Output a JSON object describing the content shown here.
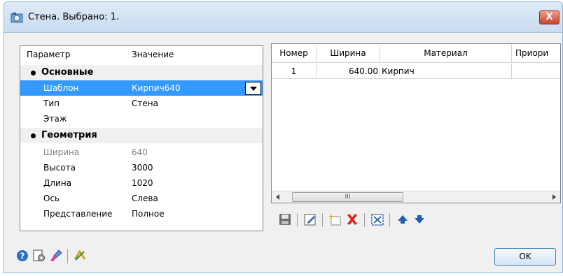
{
  "window": {
    "title": "Стена. Выбрано: 1.",
    "close_label": "X"
  },
  "properties": {
    "header": {
      "param": "Параметр",
      "value": "Значение"
    },
    "categories": [
      {
        "label": "Основные",
        "rows": [
          {
            "name": "Шаблон",
            "value": "Кирпич640",
            "selected": true
          },
          {
            "name": "Тип",
            "value": "Стена"
          },
          {
            "name": "Этаж",
            "value": ""
          }
        ]
      },
      {
        "label": "Геометрия",
        "rows": [
          {
            "name": "Ширина",
            "value": "640",
            "disabled": true
          },
          {
            "name": "Высота",
            "value": "3000"
          },
          {
            "name": "Длина",
            "value": "1020"
          },
          {
            "name": "Ось",
            "value": "Слева"
          },
          {
            "name": "Представление",
            "value": "Полное"
          }
        ]
      }
    ]
  },
  "layers": {
    "columns": [
      "Номер",
      "Ширина",
      "Материал",
      "Приори"
    ],
    "rows": [
      {
        "number": "1",
        "width": "640.00",
        "material": "Кирпич",
        "priority": ""
      }
    ],
    "scroll_thumb_label": "III"
  },
  "toolbar": {
    "icons": [
      "save-icon",
      "edit-icon",
      "add-layer-icon",
      "delete-icon",
      "select-layers-icon",
      "move-up-icon",
      "move-down-icon"
    ]
  },
  "footer": {
    "icons": [
      "help-icon",
      "settings-icon",
      "paint-brush-icon",
      "disable-icon"
    ],
    "ok_label": "OK"
  },
  "colors": {
    "selection": "#3399ff",
    "delete_red": "#e02020",
    "arrow_blue": "#1e5fb0"
  }
}
